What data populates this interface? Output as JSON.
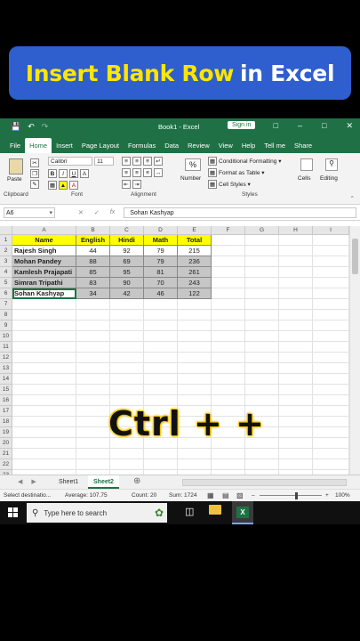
{
  "banner": {
    "title_part1": "Insert Blank Row",
    "title_part2": "in Excel"
  },
  "titlebar": {
    "doc_title": "Book1 - Excel",
    "signin": "Sign in"
  },
  "menu": {
    "tabs": [
      "File",
      "Home",
      "Insert",
      "Page Layout",
      "Formulas",
      "Data",
      "Review",
      "View",
      "Help",
      "Tell me",
      "Share"
    ],
    "active": "Home"
  },
  "ribbon": {
    "paste": "Paste",
    "clipboard": "Clipboard",
    "font_name": "Calibri",
    "font_size": "11",
    "font_group": "Font",
    "alignment": "Alignment",
    "number": "Number",
    "number_icon": "%",
    "conditional": "Conditional Formatting",
    "format_table": "Format as Table",
    "cell_styles": "Cell Styles",
    "styles": "Styles",
    "cells": "Cells",
    "editing": "Editing"
  },
  "formula": {
    "namebox": "A6",
    "fx": "fx",
    "content": "Sohan Kashyap"
  },
  "grid": {
    "columns": [
      "A",
      "B",
      "C",
      "D",
      "E",
      "F",
      "G",
      "H",
      "I"
    ],
    "rows": [
      "1",
      "2",
      "3",
      "4",
      "5",
      "6",
      "7",
      "8",
      "9",
      "10",
      "11",
      "12",
      "13",
      "14",
      "15",
      "16",
      "17",
      "18",
      "19",
      "20",
      "21",
      "22",
      "23"
    ],
    "headers": [
      "Name",
      "English",
      "Hindi",
      "Math",
      "Total"
    ],
    "data": [
      [
        "Rajesh Singh",
        "44",
        "92",
        "79",
        "215"
      ],
      [
        "Mohan Pandey",
        "88",
        "69",
        "79",
        "236"
      ],
      [
        "Kamlesh Prajapati",
        "85",
        "95",
        "81",
        "261"
      ],
      [
        "Simran Tripathi",
        "83",
        "90",
        "70",
        "243"
      ],
      [
        "Sohan Kashyap",
        "34",
        "42",
        "46",
        "122"
      ]
    ]
  },
  "overlay": {
    "shortcut": "Ctrl + +"
  },
  "sheets": {
    "tabs": [
      "Sheet1",
      "Sheet2"
    ],
    "active": "Sheet2"
  },
  "status": {
    "mode": "Select destinatio...",
    "average": "Average: 107.75",
    "count": "Count: 20",
    "sum": "Sum: 1724",
    "zoom": "100%"
  },
  "taskbar": {
    "search_placeholder": "Type here to search"
  },
  "colors": {
    "excel_green": "#1f7145",
    "header_yellow": "#ffff00",
    "banner_blue": "#2f5ecf",
    "banner_yellow": "#ffe600"
  }
}
